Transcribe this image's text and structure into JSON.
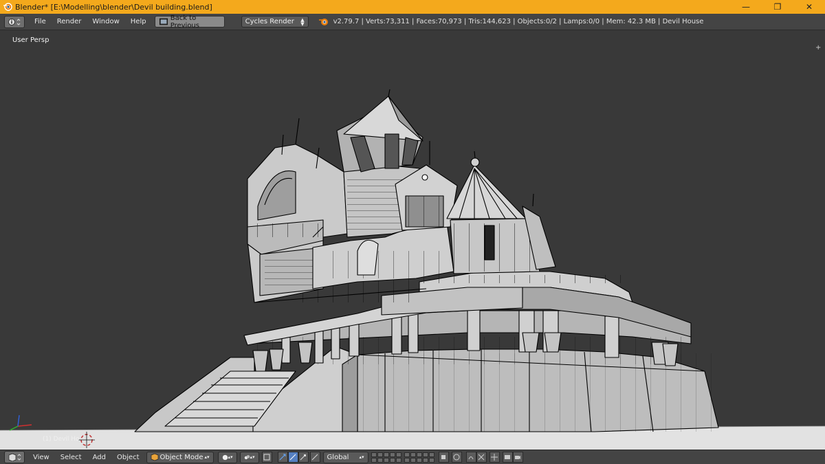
{
  "window": {
    "title": "Blender* [E:\\Modelling\\blender\\Devil building.blend]",
    "minimize_glyph": "—",
    "restore_glyph": "❐",
    "close_glyph": "✕"
  },
  "info_header": {
    "menus": [
      "File",
      "Render",
      "Window",
      "Help"
    ],
    "back_button": "Back to Previous",
    "render_engine": "Cycles Render",
    "stats": "v2.79.7 | Verts:73,311 | Faces:70,973 | Tris:144,623 | Objects:0/2 | Lamps:0/0 | Mem: 42.3 MB | Devil House"
  },
  "viewport": {
    "view_label": "User Persp",
    "object_label": "(1) Devil Ho",
    "plus_glyph": "+"
  },
  "footer": {
    "menus": [
      "View",
      "Select",
      "Add",
      "Object"
    ],
    "mode": "Object Mode",
    "orientation": "Global"
  },
  "colors": {
    "titlebar": "#f4a91c",
    "viewport_bg": "#393939",
    "mesh_fill": "#c9c9c9",
    "wire": "#000000",
    "active_tool": "#5680c2"
  },
  "icons": [
    "blender-logo-icon",
    "editor-type-icon",
    "shading-icon",
    "translate-icon",
    "rotate-icon",
    "scale-icon",
    "layers-icon",
    "snap-icon",
    "render-icon",
    "camera-icon"
  ]
}
